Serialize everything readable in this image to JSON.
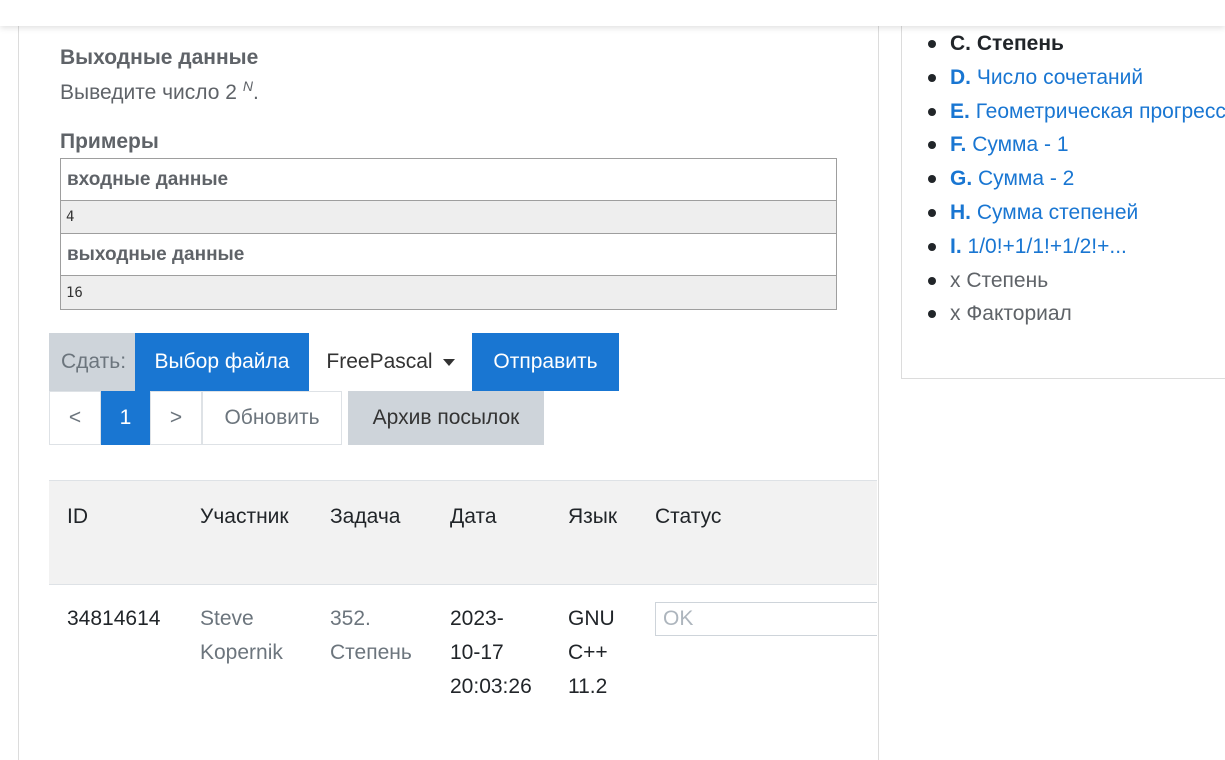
{
  "statement": {
    "output_heading": "Выходные данные",
    "output_text": "Выведите число 2",
    "output_exponent": "N",
    "output_end": ".",
    "examples_heading": "Примеры",
    "samples": [
      {
        "input_label": "входные данные",
        "input_value": "4",
        "output_label": "выходные данные",
        "output_value": "16"
      }
    ]
  },
  "submit": {
    "label": "Сдать:",
    "file_button": "Выбор файла",
    "language": "FreePascal",
    "send_button": "Отправить"
  },
  "pager": {
    "prev": "<",
    "current_page": "1",
    "next": ">",
    "refresh": "Обновить",
    "archive": "Архив посылок"
  },
  "submissions": {
    "columns": [
      "ID",
      "Участник",
      "Задача",
      "Дата",
      "Язык",
      "Статус"
    ],
    "rows": [
      {
        "id": "34814614",
        "participant": [
          "Steve",
          "Kopernik"
        ],
        "task": [
          "352.",
          "Степень"
        ],
        "date": [
          "2023-",
          "10-17",
          "20:03:26"
        ],
        "lang": [
          "GNU",
          "C++",
          "11.2"
        ],
        "status": "OK"
      }
    ]
  },
  "problem_list": [
    {
      "letter": "C.",
      "name": "Степень",
      "current": true
    },
    {
      "letter": "D.",
      "name": "Число сочетаний"
    },
    {
      "letter": "E.",
      "name": "Геометрическая прогрессия"
    },
    {
      "letter": "F.",
      "name": "Сумма - 1"
    },
    {
      "letter": "G.",
      "name": "Сумма - 2"
    },
    {
      "letter": "H.",
      "name": "Сумма степеней"
    },
    {
      "letter": "I.",
      "name": "1/0!+1/1!+1/2!+..."
    },
    {
      "letter": "",
      "name": "x Степень",
      "extra": true
    },
    {
      "letter": "",
      "name": "x Факториал",
      "extra": true
    }
  ],
  "colors": {
    "accent": "#1976d2",
    "muted": "#6c757d",
    "panel": "#ced4da"
  }
}
